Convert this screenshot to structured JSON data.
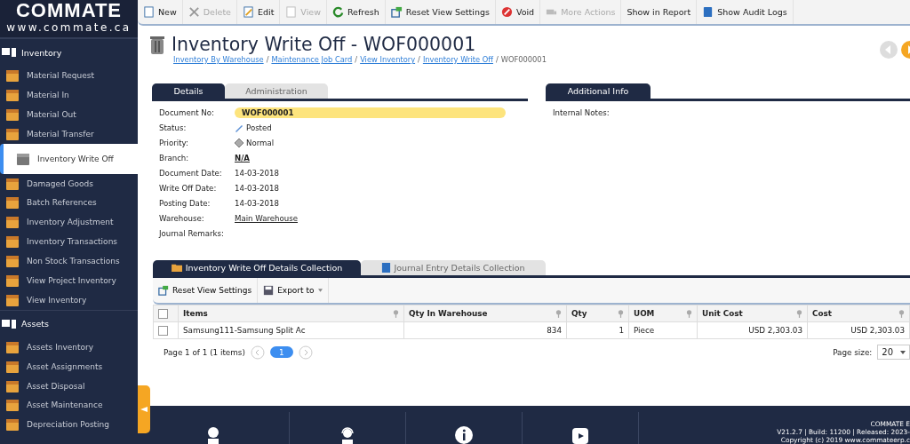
{
  "logo": {
    "name": "COMMATE",
    "url": "www.commate.ca"
  },
  "sidebar": {
    "sections": [
      {
        "title": "Inventory",
        "items": [
          {
            "label": "Material Request",
            "selected": false
          },
          {
            "label": "Material In",
            "selected": false
          },
          {
            "label": "Material Out",
            "selected": false
          },
          {
            "label": "Material Transfer",
            "selected": false
          },
          {
            "label": "Inventory Write Off",
            "selected": true
          },
          {
            "label": "Damaged Goods",
            "selected": false
          },
          {
            "label": "Batch References",
            "selected": false
          },
          {
            "label": "Inventory Adjustment",
            "selected": false
          },
          {
            "label": "Inventory Transactions",
            "selected": false
          },
          {
            "label": "Non Stock Transactions",
            "selected": false
          },
          {
            "label": "View Project Inventory",
            "selected": false
          },
          {
            "label": "View Inventory",
            "selected": false
          }
        ]
      },
      {
        "title": "Assets",
        "items": [
          {
            "label": "Assets Inventory",
            "selected": false
          },
          {
            "label": "Asset Assignments",
            "selected": false
          },
          {
            "label": "Asset Disposal",
            "selected": false
          },
          {
            "label": "Asset Maintenance",
            "selected": false
          },
          {
            "label": "Depreciation Posting",
            "selected": false
          }
        ]
      }
    ]
  },
  "toolbar": [
    {
      "label": "New",
      "kind": "new",
      "disabled": false
    },
    {
      "label": "Delete",
      "kind": "delete",
      "disabled": true
    },
    {
      "label": "Edit",
      "kind": "edit",
      "disabled": false
    },
    {
      "label": "View",
      "kind": "view",
      "disabled": true
    },
    {
      "label": "Refresh",
      "kind": "refresh",
      "disabled": false
    },
    {
      "label": "Reset View Settings",
      "kind": "reset",
      "disabled": false
    },
    {
      "label": "Void",
      "kind": "void",
      "disabled": false
    },
    {
      "label": "More Actions",
      "kind": "more",
      "disabled": true
    },
    {
      "label": "Show in Report",
      "kind": "plain",
      "disabled": false
    },
    {
      "label": "Show Audit Logs",
      "kind": "audit",
      "disabled": false
    }
  ],
  "page": {
    "title": "Inventory Write Off - WOF000001",
    "breadcrumb": [
      {
        "label": "Inventory By Warehouse",
        "kind": "link"
      },
      {
        "label": "/",
        "kind": "separator"
      },
      {
        "label": "Maintenance Job Card",
        "kind": "link"
      },
      {
        "label": "/",
        "kind": "separator"
      },
      {
        "label": "View Inventory",
        "kind": "link"
      },
      {
        "label": "/",
        "kind": "separator"
      },
      {
        "label": "Inventory Write Off",
        "kind": "link"
      },
      {
        "label": "/",
        "kind": "separator"
      },
      {
        "label": "WOF000001",
        "kind": "current"
      }
    ]
  },
  "detail_tabs": [
    {
      "label": "Details",
      "selected": true
    },
    {
      "label": "Administration",
      "selected": false
    }
  ],
  "fields": [
    {
      "label": "Document No:",
      "value": "WOF000001",
      "kind": "highlight"
    },
    {
      "label": "Status:",
      "value": "Posted",
      "kind": "status"
    },
    {
      "label": "Priority:",
      "value": "Normal",
      "kind": "priority"
    },
    {
      "label": "Branch:",
      "value": "N/A",
      "kind": "boldlink"
    },
    {
      "label": "Document Date:",
      "value": "14-03-2018",
      "kind": "text"
    },
    {
      "label": "Write Off Date:",
      "value": "14-03-2018",
      "kind": "text"
    },
    {
      "label": "Posting Date:",
      "value": "14-03-2018",
      "kind": "text"
    },
    {
      "label": "Warehouse:",
      "value": "Main Warehouse",
      "kind": "link"
    },
    {
      "label": "Journal Remarks:"
    }
  ],
  "info_tabs": [
    {
      "label": "Additional Info",
      "selected": true
    }
  ],
  "info_fields": [
    {
      "label": "Internal Notes:"
    }
  ],
  "collection_tabs": [
    {
      "label": "Inventory Write Off Details Collection",
      "selected": true,
      "kind": "folder"
    },
    {
      "label": "Journal Entry Details Collection",
      "selected": false,
      "kind": "book"
    }
  ],
  "grid_toolbar": [
    {
      "label": "Reset View Settings",
      "kind": "reset"
    },
    {
      "label": "Export to",
      "kind": "export"
    }
  ],
  "table": {
    "all_checked": false,
    "columns": [
      {
        "label": "Items",
        "kind": "text"
      },
      {
        "label": "Qty In Warehouse",
        "kind": "number"
      },
      {
        "label": "Qty",
        "kind": "number"
      },
      {
        "label": "UOM",
        "kind": "text"
      },
      {
        "label": "Unit Cost",
        "kind": "number"
      },
      {
        "label": "Cost",
        "kind": "number"
      }
    ],
    "rows": [
      {
        "checked": false,
        "cells": [
          "Samsung111-Samsung Split Ac",
          "834",
          "1",
          "Piece",
          "USD 2,303.03",
          "USD 2,303.03"
        ]
      }
    ]
  },
  "pager": {
    "summary": "Page 1 of 1 (1 items)",
    "pages": [
      {
        "label": "1",
        "selected": true
      }
    ],
    "size_label": "Page size:",
    "size": "20"
  },
  "footer": {
    "lines": [
      "COMMATE E",
      "V21.2.7 | Build: 11200 | Released: 2023-",
      "Copyright (c) 2019 www.commateerp.c"
    ]
  }
}
